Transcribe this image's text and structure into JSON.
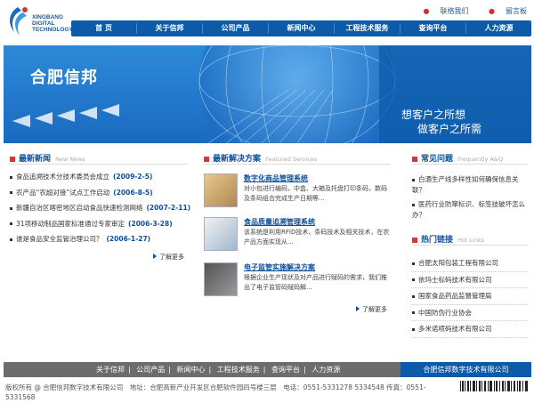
{
  "logo": {
    "line1": "XINGBANG",
    "line2": "DIGITAL",
    "line3": "TECHNOLOGY"
  },
  "toplinks": [
    {
      "label": "联络我们"
    },
    {
      "label": "留言板"
    }
  ],
  "nav": [
    "首 页",
    "关于信邦",
    "公司产品",
    "新闻中心",
    "工程技术服务",
    "查询平台",
    "人力资源"
  ],
  "banner": {
    "logo_text": "合肥信邦",
    "slogan1": "想客户之所想",
    "slogan2": "做客户之所需"
  },
  "news": {
    "title": "最新新闻",
    "title_en": "New News",
    "items": [
      {
        "text": "食品追溯技术分技术委员会成立",
        "date": "(2009-2-5)"
      },
      {
        "text": "农产品“农超对接”试点工作启动",
        "date": "(2006-8-5)"
      },
      {
        "text": "新疆自治区喀密地区启动食品快速检测网络",
        "date": "(2007-2-11)"
      },
      {
        "text": "31项移动制品国家标准通过专家审定",
        "date": "(2006-3-28)"
      },
      {
        "text": "谁是食品安全监管治理公司？",
        "date": "(2006-1-27)"
      }
    ],
    "more": "了解更多"
  },
  "solutions": {
    "title": "最新解决方案",
    "title_en": "Featured Services",
    "items": [
      {
        "title": "数字化商品管理系统",
        "desc": "对小包进行编码，中盒、大箱及托盘打印条码，数码及条码组合完成生产日期等..."
      },
      {
        "title": "食品质量追溯管理系统",
        "desc": "该系统是利用RFID技术、条码技术及相关技术，在农产品方面实现从..."
      },
      {
        "title": "电子监管实施解决方案",
        "desc": "根据企业生产现状及对产品进行赋码的需求，我们推出了电子监管码赋码解..."
      }
    ],
    "more": "了解更多"
  },
  "faq": {
    "title": "常见问题",
    "title_en": "Frequently A&Q",
    "items": [
      "白酒生产线多样性如何确保信息关联？",
      "医药行业防窜标识、标签技破坏怎么办？"
    ]
  },
  "links": {
    "title": "热门链接",
    "title_en": "Hot Links",
    "items": [
      "合肥太阳包装工程有限公司",
      "依玛士标码技术有限公司",
      "国家食品药品监督管理局",
      "中国防伪行业协会",
      "多米诺喷码技术有限公司"
    ]
  },
  "footer": {
    "nav": [
      "关于信邦",
      "公司产品",
      "新闻中心",
      "工程技术服务",
      "查询平台",
      "人力资源"
    ],
    "separator": "|",
    "company": "合肥信邦数字技术有限公司",
    "copyright": "版权所有 @ 合肥信邦数字技术有限公司　地址：合肥高新产业开发区合肥软件园四号楼三层　电话：0551-5331278 5334548 传真：0551-5331568"
  }
}
